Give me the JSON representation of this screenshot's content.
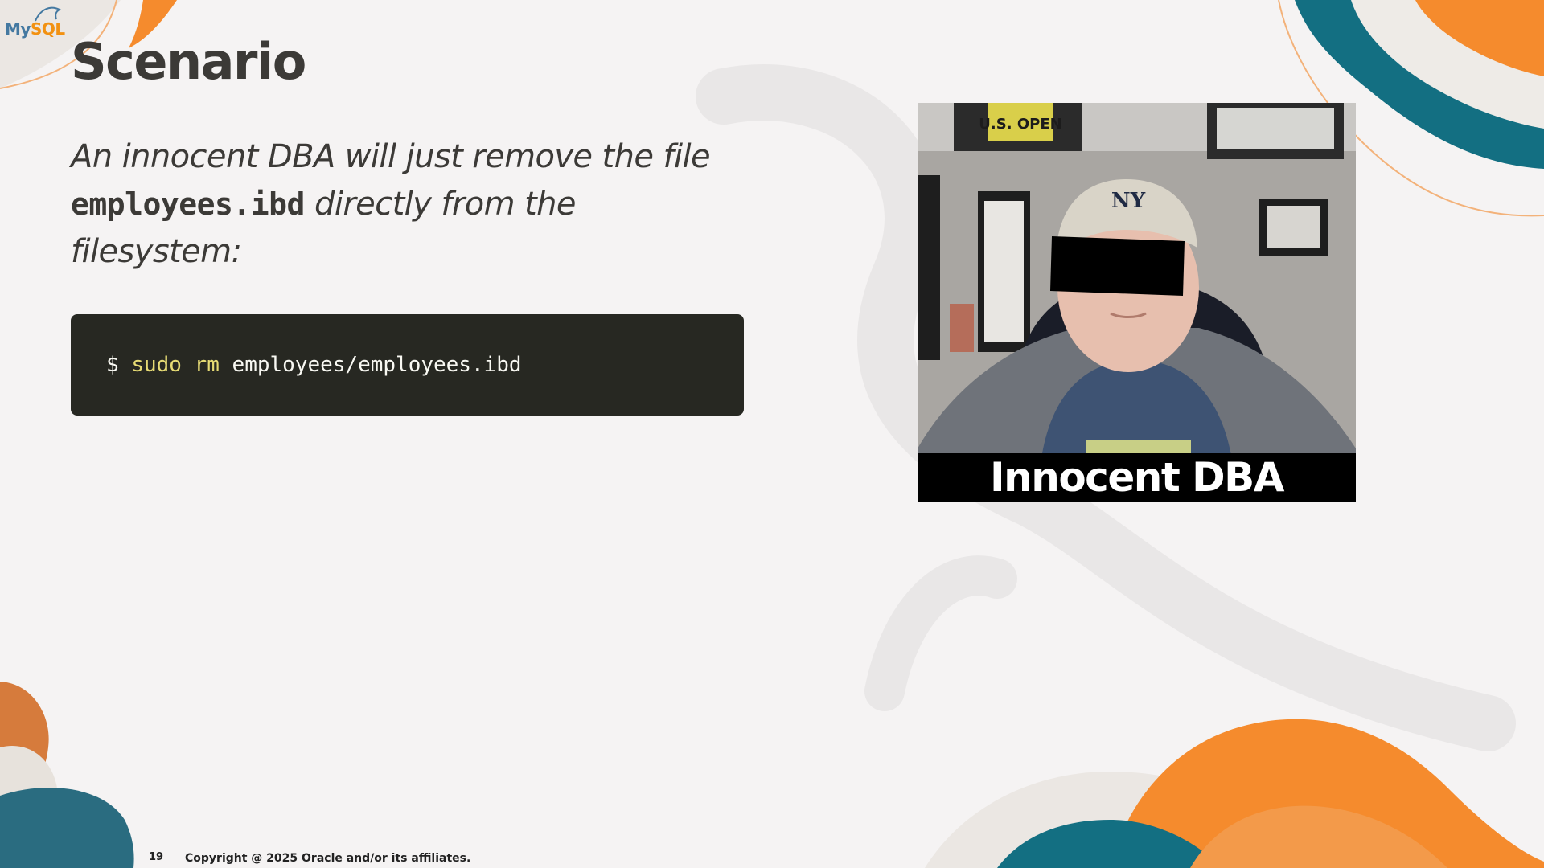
{
  "brand": {
    "logo_prefix": "My",
    "logo_suffix": "SQL",
    "colors": {
      "blue": "#4479a1",
      "orange": "#f29111",
      "teal": "#136f82",
      "dark": "#3c3a37"
    }
  },
  "slide": {
    "title": "Scenario",
    "lead_before": "An innocent DBA will just remove the file ",
    "lead_code": "employees.ibd",
    "lead_after": " directly from the filesystem:",
    "command": {
      "prompt": "$ ",
      "keyword": "sudo rm",
      "argument": " employees/employees.ibd"
    },
    "photo": {
      "caption": "Innocent DBA",
      "banner_text": "U.S. OPEN",
      "cap_logo": "NY"
    }
  },
  "footer": {
    "page_number": "19",
    "copyright": "Copyright @ 2025 Oracle and/or its affiliates."
  }
}
